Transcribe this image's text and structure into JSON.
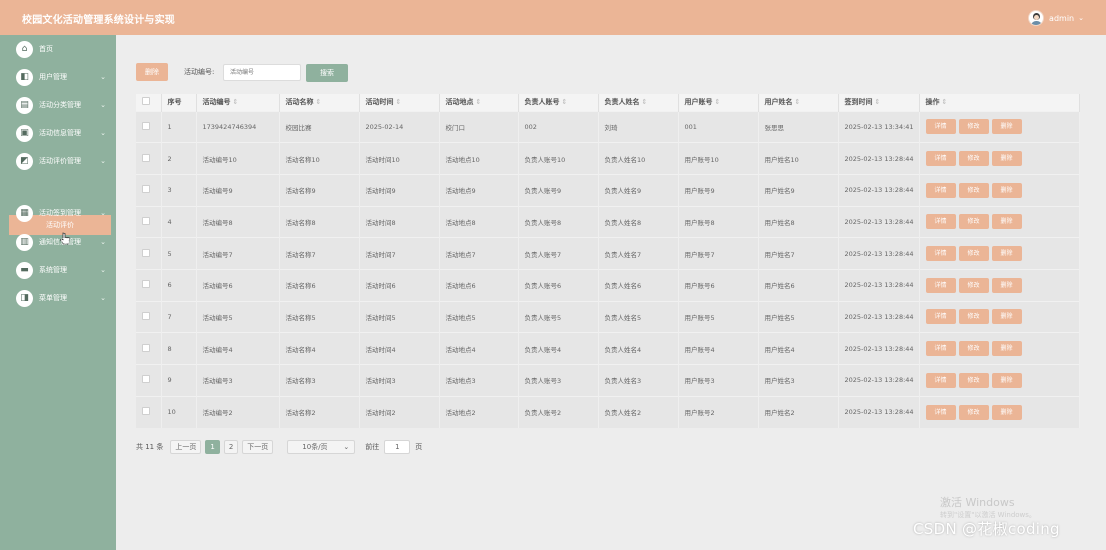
{
  "header": {
    "title": "校园文化活动管理系统设计与实现",
    "username": "admin",
    "caret": "⌄"
  },
  "sidebar": {
    "items": [
      {
        "label": "首页",
        "icon": "home-icon",
        "glyph": "⌂"
      },
      {
        "label": "用户管理",
        "icon": "user-icon",
        "glyph": "◧"
      },
      {
        "label": "活动分类管理",
        "icon": "category-icon",
        "glyph": "▤"
      },
      {
        "label": "活动信息管理",
        "icon": "activity-info-icon",
        "glyph": "▣"
      },
      {
        "label": "活动评价管理",
        "icon": "evaluation-icon",
        "glyph": "◩"
      },
      {
        "label": "活动签到管理",
        "icon": "signin-icon",
        "glyph": "▦"
      },
      {
        "label": "通知信息管理",
        "icon": "notice-icon",
        "glyph": "▥"
      },
      {
        "label": "系统管理",
        "icon": "system-icon",
        "glyph": "▬"
      },
      {
        "label": "菜单管理",
        "icon": "menu-manage-icon",
        "glyph": "◨"
      }
    ],
    "arrow": "⌄",
    "active_sub": "活动评价"
  },
  "toolbar": {
    "delete_label": "删除",
    "filter_label": "活动编号:",
    "filter_placeholder": "活动编号",
    "search_label": "搜索"
  },
  "table": {
    "sort_glyph": "⇕",
    "columns": [
      "序号",
      "活动编号",
      "活动名称",
      "活动时间",
      "活动地点",
      "负责人账号",
      "负责人姓名",
      "用户账号",
      "用户姓名",
      "签到时间",
      "操作"
    ],
    "rows": [
      [
        "1",
        "1739424746394",
        "校园比赛",
        "2025-02-14",
        "校门口",
        "002",
        "刘琦",
        "001",
        "张思思",
        "2025-02-13 13:34:41"
      ],
      [
        "2",
        "活动编号10",
        "活动名称10",
        "活动时间10",
        "活动地点10",
        "负责人账号10",
        "负责人姓名10",
        "用户账号10",
        "用户姓名10",
        "2025-02-13 13:28:44"
      ],
      [
        "3",
        "活动编号9",
        "活动名称9",
        "活动时间9",
        "活动地点9",
        "负责人账号9",
        "负责人姓名9",
        "用户账号9",
        "用户姓名9",
        "2025-02-13 13:28:44"
      ],
      [
        "4",
        "活动编号8",
        "活动名称8",
        "活动时间8",
        "活动地点8",
        "负责人账号8",
        "负责人姓名8",
        "用户账号8",
        "用户姓名8",
        "2025-02-13 13:28:44"
      ],
      [
        "5",
        "活动编号7",
        "活动名称7",
        "活动时间7",
        "活动地点7",
        "负责人账号7",
        "负责人姓名7",
        "用户账号7",
        "用户姓名7",
        "2025-02-13 13:28:44"
      ],
      [
        "6",
        "活动编号6",
        "活动名称6",
        "活动时间6",
        "活动地点6",
        "负责人账号6",
        "负责人姓名6",
        "用户账号6",
        "用户姓名6",
        "2025-02-13 13:28:44"
      ],
      [
        "7",
        "活动编号5",
        "活动名称5",
        "活动时间5",
        "活动地点5",
        "负责人账号5",
        "负责人姓名5",
        "用户账号5",
        "用户姓名5",
        "2025-02-13 13:28:44"
      ],
      [
        "8",
        "活动编号4",
        "活动名称4",
        "活动时间4",
        "活动地点4",
        "负责人账号4",
        "负责人姓名4",
        "用户账号4",
        "用户姓名4",
        "2025-02-13 13:28:44"
      ],
      [
        "9",
        "活动编号3",
        "活动名称3",
        "活动时间3",
        "活动地点3",
        "负责人账号3",
        "负责人姓名3",
        "用户账号3",
        "用户姓名3",
        "2025-02-13 13:28:44"
      ],
      [
        "10",
        "活动编号2",
        "活动名称2",
        "活动时间2",
        "活动地点2",
        "负责人账号2",
        "负责人姓名2",
        "用户账号2",
        "用户姓名2",
        "2025-02-13 13:28:44"
      ]
    ],
    "actions": {
      "detail": "详情",
      "edit": "修改",
      "delete": "删除"
    }
  },
  "pager": {
    "total": "共 11 条",
    "prev": "上一页",
    "pages": [
      "1",
      "2"
    ],
    "current_page": "1",
    "next": "下一页",
    "page_size": "10条/页",
    "size_caret": "⌄",
    "goto_label": "前往",
    "goto_value": "1",
    "page_unit": "页"
  },
  "overlay": {
    "activate_title": "激活 Windows",
    "activate_hint": "转到\"设置\"以激活 Windows。",
    "csdn_mark": "CSDN @花椒coding"
  },
  "colors": {
    "accent_peach": "#ebb596",
    "sidebar_green": "#8fb19e",
    "content_bg": "#ededed"
  }
}
